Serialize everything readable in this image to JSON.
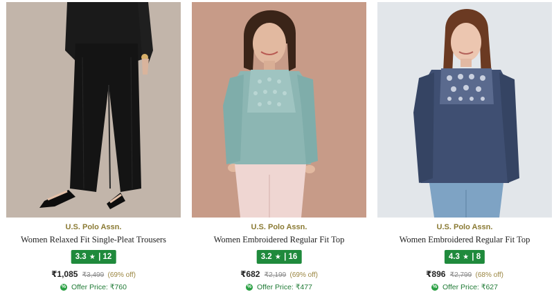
{
  "products": [
    {
      "brand": "U.S. Polo Assn.",
      "title": "Women Relaxed Fit Single-Pleat Trousers",
      "rating": "3.3",
      "rating_count": "12",
      "price": "₹1,085",
      "mrp": "₹3,499",
      "discount": "(69% off)",
      "offer_price": "Offer Price: ₹760",
      "image_alt": "woman in black trousers"
    },
    {
      "brand": "U.S. Polo Assn.",
      "title": "Women Embroidered Regular Fit Top",
      "rating": "3.2",
      "rating_count": "16",
      "price": "₹682",
      "mrp": "₹2,199",
      "discount": "(69% off)",
      "offer_price": "Offer Price: ₹477",
      "image_alt": "woman in sage green embroidered top"
    },
    {
      "brand": "U.S. Polo Assn.",
      "title": "Women Embroidered Regular Fit Top",
      "rating": "4.3",
      "rating_count": "8",
      "price": "₹896",
      "mrp": "₹2,799",
      "discount": "(68% off)",
      "offer_price": "Offer Price: ₹627",
      "image_alt": "woman in navy embroidered top"
    }
  ],
  "icons": {
    "star": "★",
    "offer": "%"
  },
  "colors": {
    "rating_badge": "#1f8a3c",
    "brand_text": "#8a7a33",
    "offer_text": "#1f7a35"
  }
}
